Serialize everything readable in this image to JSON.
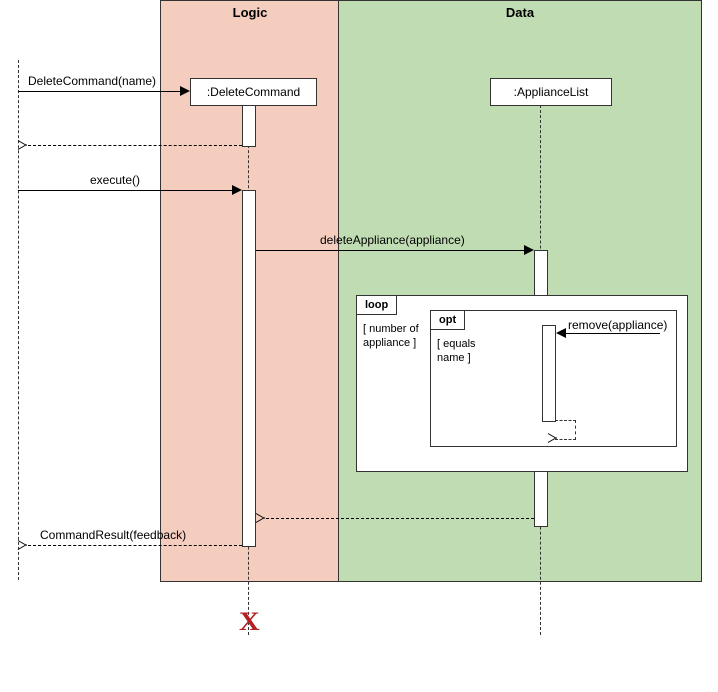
{
  "regions": {
    "logic": {
      "title": "Logic"
    },
    "data": {
      "title": "Data"
    }
  },
  "lifelines": {
    "deleteCommand": {
      "label": ":DeleteCommand"
    },
    "applianceList": {
      "label": ":ApplianceList"
    }
  },
  "messages": {
    "create": "DeleteCommand(name)",
    "execute": "execute()",
    "deleteAppliance": "deleteAppliance(appliance)",
    "remove": "remove(appliance)",
    "result": "CommandResult(feedback)"
  },
  "fragments": {
    "loop": {
      "label": "loop",
      "guard": "[ number of\nappliance ]"
    },
    "opt": {
      "label": "opt",
      "guard": "[ equals\nname ]"
    }
  },
  "symbols": {
    "destroy": "X"
  }
}
